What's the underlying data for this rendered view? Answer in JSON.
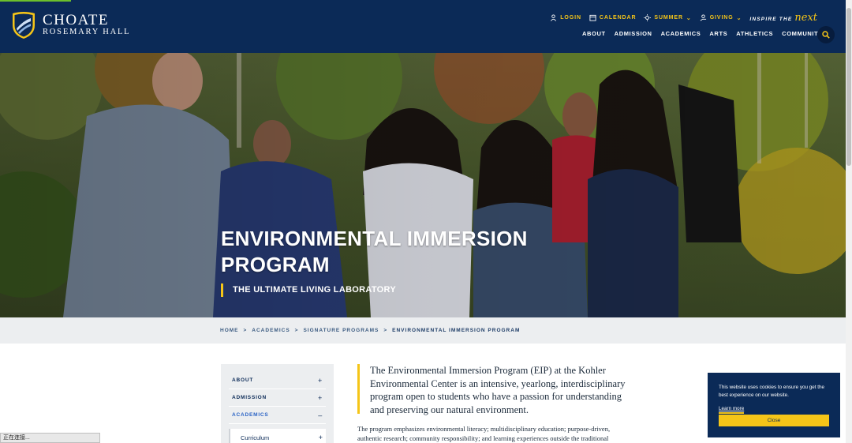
{
  "header": {
    "logo_line1": "CHOATE",
    "logo_line2": "ROSEMARY HALL",
    "utility": {
      "login": "LOGIN",
      "calendar": "CALENDAR",
      "summer": "SUMMER",
      "giving": "GIVING",
      "inspire_prefix": "INSPIRE THE",
      "inspire_word": "next"
    },
    "nav": [
      "ABOUT",
      "ADMISSION",
      "ACADEMICS",
      "ARTS",
      "ATHLETICS",
      "COMMUNITY"
    ],
    "colors": {
      "navy": "#0b2a57",
      "gold": "#f5c518"
    }
  },
  "hero": {
    "title": "ENVIRONMENTAL IMMERSION PROGRAM",
    "subtitle": "THE ULTIMATE LIVING LABORATORY"
  },
  "breadcrumb": {
    "items": [
      "HOME",
      "ACADEMICS",
      "SIGNATURE PROGRAMS",
      "ENVIRONMENTAL IMMERSION PROGRAM"
    ],
    "separator": ">"
  },
  "sidebar": {
    "items": [
      {
        "label": "ABOUT",
        "toggle": "+"
      },
      {
        "label": "ADMISSION",
        "toggle": "+"
      },
      {
        "label": "ACADEMICS",
        "toggle": "–"
      }
    ],
    "sub": {
      "label": "Curriculum",
      "toggle": "+"
    }
  },
  "content": {
    "lead": "The Environmental Immersion Program (EIP) at the Kohler Environmental Center is an intensive, yearlong, interdisciplinary program open to students who have a passion for understanding and preserving our natural environment.",
    "body": "The program emphasizes environmental literacy; multidisciplinary education; purpose-driven, authentic research; community responsibility; and learning experiences outside the traditional"
  },
  "cookie": {
    "message": "This website uses cookies to ensure you get the best experience on our website.",
    "learn_more": "Learn more",
    "close": "Close"
  },
  "status_bar": "正在连接..."
}
